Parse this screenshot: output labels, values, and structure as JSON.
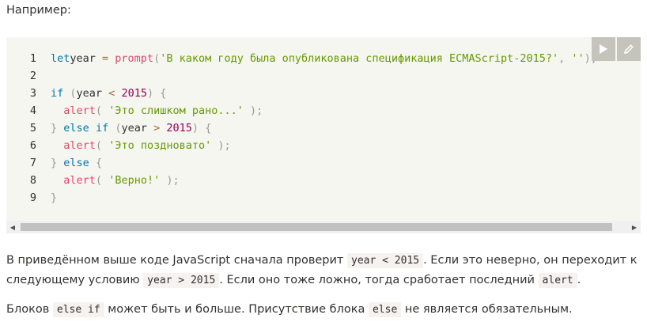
{
  "intro": "Например:",
  "code": {
    "lines": [
      {
        "n": "1",
        "tokens": [
          [
            "kw",
            "let"
          ],
          [
            "",
            "year "
          ],
          [
            "op",
            "="
          ],
          [
            "fn",
            " prompt"
          ],
          [
            "pu",
            "("
          ],
          [
            "str",
            "'В каком году была опубликована спецификация ECMAScript-2015?'"
          ],
          [
            "pu",
            ","
          ],
          [
            "str",
            " ''"
          ],
          [
            "pu",
            ");"
          ]
        ]
      },
      {
        "n": "2",
        "tokens": []
      },
      {
        "n": "3",
        "tokens": [
          [
            "kw",
            "if"
          ],
          [
            "",
            " "
          ],
          [
            "pu",
            "("
          ],
          [
            "",
            "year "
          ],
          [
            "op",
            "<"
          ],
          [
            "",
            " "
          ],
          [
            "num",
            "2015"
          ],
          [
            "pu",
            ")"
          ],
          [
            "",
            " "
          ],
          [
            "pu",
            "{"
          ]
        ]
      },
      {
        "n": "4",
        "tokens": [
          [
            "",
            " "
          ],
          [
            "fn",
            " alert"
          ],
          [
            "pu",
            "("
          ],
          [
            "",
            " "
          ],
          [
            "str",
            "'Это слишком рано...'"
          ],
          [
            "",
            " "
          ],
          [
            "pu",
            ");"
          ]
        ]
      },
      {
        "n": "5",
        "tokens": [
          [
            "pu",
            "}"
          ],
          [
            "",
            " "
          ],
          [
            "kw",
            "else"
          ],
          [
            "",
            " "
          ],
          [
            "kw",
            "if"
          ],
          [
            "",
            " "
          ],
          [
            "pu",
            "("
          ],
          [
            "",
            "year "
          ],
          [
            "op",
            ">"
          ],
          [
            "",
            " "
          ],
          [
            "num",
            "2015"
          ],
          [
            "pu",
            ")"
          ],
          [
            "",
            " "
          ],
          [
            "pu",
            "{"
          ]
        ]
      },
      {
        "n": "6",
        "tokens": [
          [
            "",
            " "
          ],
          [
            "fn",
            " alert"
          ],
          [
            "pu",
            "("
          ],
          [
            "",
            " "
          ],
          [
            "str",
            "'Это поздновато'"
          ],
          [
            "",
            " "
          ],
          [
            "pu",
            ");"
          ]
        ]
      },
      {
        "n": "7",
        "tokens": [
          [
            "pu",
            "}"
          ],
          [
            "",
            " "
          ],
          [
            "kw",
            "else"
          ],
          [
            "",
            " "
          ],
          [
            "pu",
            "{"
          ]
        ]
      },
      {
        "n": "8",
        "tokens": [
          [
            "",
            " "
          ],
          [
            "fn",
            " alert"
          ],
          [
            "pu",
            "("
          ],
          [
            "",
            " "
          ],
          [
            "str",
            "'Верно!'"
          ],
          [
            "",
            " "
          ],
          [
            "pu",
            ");"
          ]
        ]
      },
      {
        "n": "9",
        "tokens": [
          [
            "pu",
            "}"
          ]
        ]
      }
    ]
  },
  "toolbar": {
    "run_icon": "play-icon",
    "edit_icon": "pencil-icon"
  },
  "para1": {
    "t1": "В приведённом выше коде JavaScript сначала проверит ",
    "c1": "year < 2015",
    "t2": ". Если это неверно, он переходит к следующему условию ",
    "c2": "year > 2015",
    "t3": ". Если оно тоже ложно, тогда сработает последний ",
    "c3": "alert",
    "t4": "."
  },
  "para2": {
    "t1": "Блоков ",
    "c1": "else if",
    "t2": " может быть и больше. Присутствие блока ",
    "c2": "else",
    "t3": " не является обязательным."
  }
}
